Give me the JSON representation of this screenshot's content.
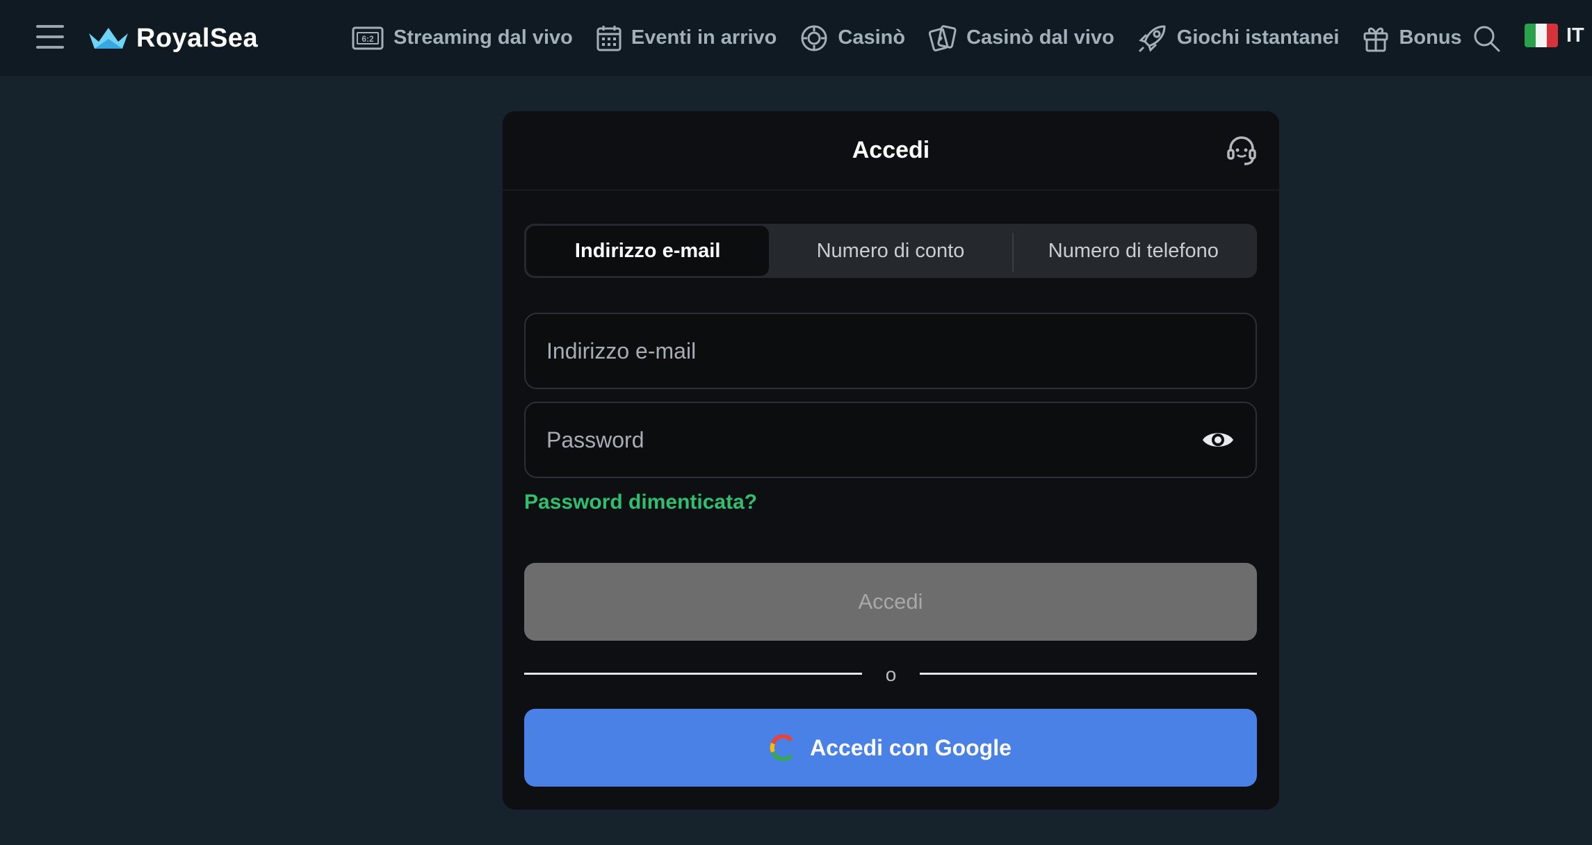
{
  "header": {
    "logo_text": "RoyalSea",
    "nav": [
      {
        "label": "Streaming dal vivo",
        "icon": "scoreboard-icon"
      },
      {
        "label": "Eventi in arrivo",
        "icon": "calendar-icon"
      },
      {
        "label": "Casinò",
        "icon": "casino-chip-icon"
      },
      {
        "label": "Casinò dal vivo",
        "icon": "playing-cards-icon"
      },
      {
        "label": "Giochi istantanei",
        "icon": "rocket-icon"
      },
      {
        "label": "Bonus",
        "icon": "gift-icon"
      }
    ],
    "scoreboard_glyph": "6:2",
    "language_code": "IT"
  },
  "login": {
    "title": "Accedi",
    "tabs": [
      {
        "label": "Indirizzo e-mail",
        "active": true
      },
      {
        "label": "Numero di conto",
        "active": false
      },
      {
        "label": "Numero di telefono",
        "active": false
      }
    ],
    "email_placeholder": "Indirizzo e-mail",
    "email_value": "",
    "password_placeholder": "Password",
    "password_value": "",
    "forgot_label": "Password dimenticata?",
    "submit_label": "Accedi",
    "or_label": "o",
    "google_label": "Accedi con Google"
  },
  "colors": {
    "page_bg": "#16222c",
    "topbar_bg": "#0f1a22",
    "modal_bg": "#0d0f12",
    "accent_green": "#2fbf6f",
    "google_blue": "#4a81e6",
    "submit_disabled": "#6d6d6e"
  }
}
